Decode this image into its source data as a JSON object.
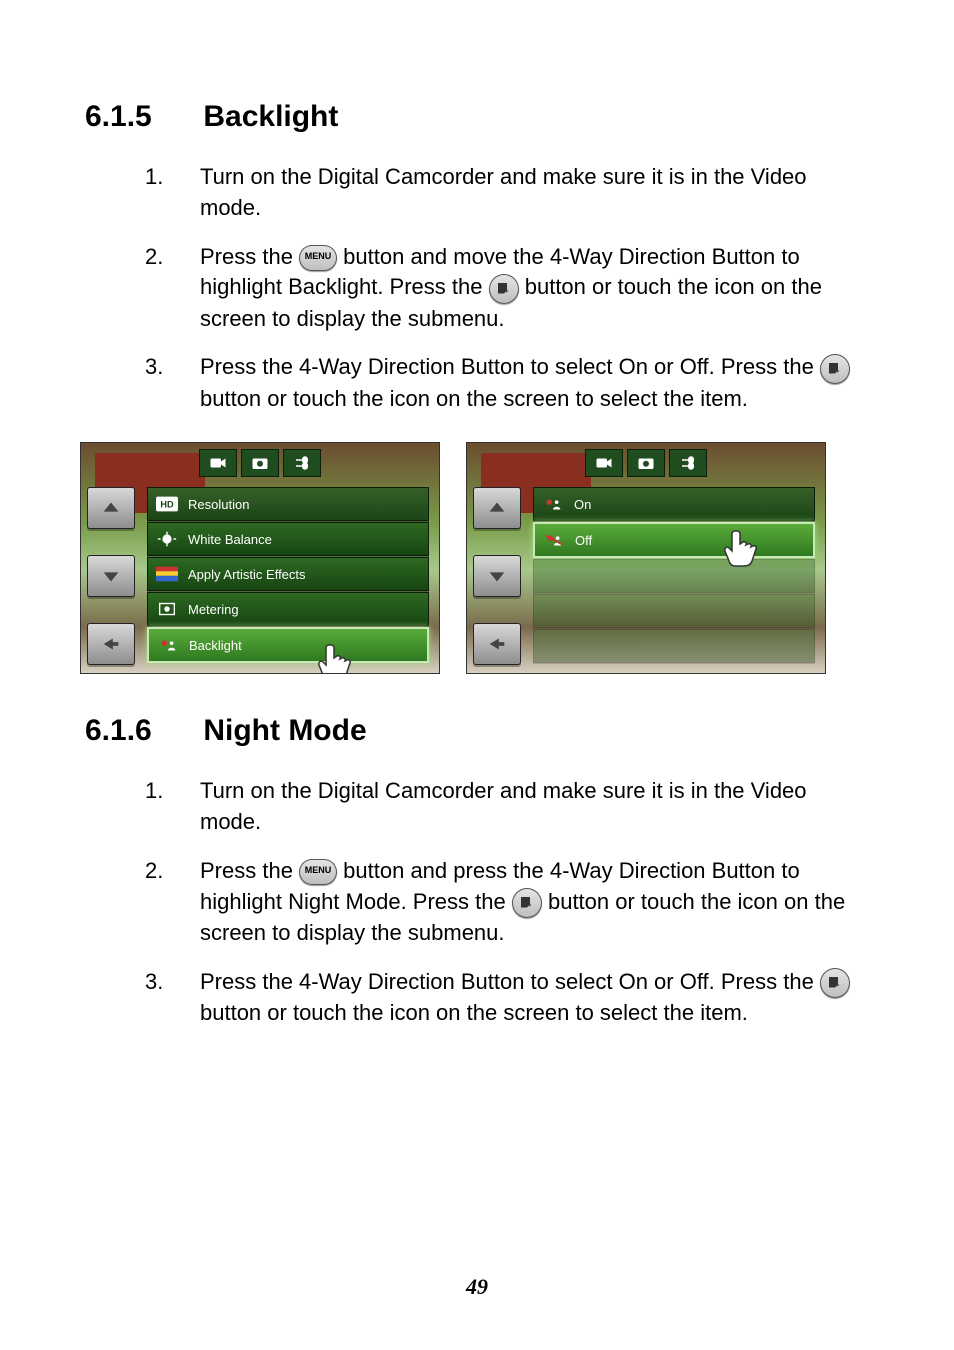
{
  "section1": {
    "num": "6.1.5",
    "title": "Backlight",
    "steps": [
      {
        "n": "1.",
        "parts": [
          "Turn on the Digital Camcorder and make sure it is in the Video mode."
        ]
      },
      {
        "n": "2.",
        "parts": [
          "Press the ",
          "MENU",
          " button and move the 4-Way Direction Button to highlight Backlight. Press the ",
          "OK",
          " button or touch the icon on the screen to display the submenu."
        ]
      },
      {
        "n": "3.",
        "parts": [
          "Press the 4-Way Direction Button to select On or Off. Press the ",
          "OK",
          " button or touch the icon on the screen to select the item."
        ]
      }
    ]
  },
  "section2": {
    "num": "6.1.6",
    "title": "Night Mode",
    "steps": [
      {
        "n": "1.",
        "parts": [
          "Turn on the Digital Camcorder and make sure it is in the Video mode."
        ]
      },
      {
        "n": "2.",
        "parts": [
          "Press the ",
          "MENU",
          " button and press the 4-Way Direction Button to highlight Night Mode. Press the ",
          "OK",
          " button or touch the icon on the screen to display the submenu."
        ]
      },
      {
        "n": "3.",
        "parts": [
          "Press the 4-Way Direction Button to select On or Off. Press the ",
          "OK",
          " button or touch the icon on the screen to select the item."
        ]
      }
    ]
  },
  "screenshot1": {
    "items": [
      "Resolution",
      "White Balance",
      "Apply Artistic Effects",
      "Metering",
      "Backlight"
    ]
  },
  "screenshot2": {
    "items": [
      "On",
      "Off"
    ]
  },
  "icons": {
    "menu_label": "MENU"
  },
  "page_number": "49"
}
